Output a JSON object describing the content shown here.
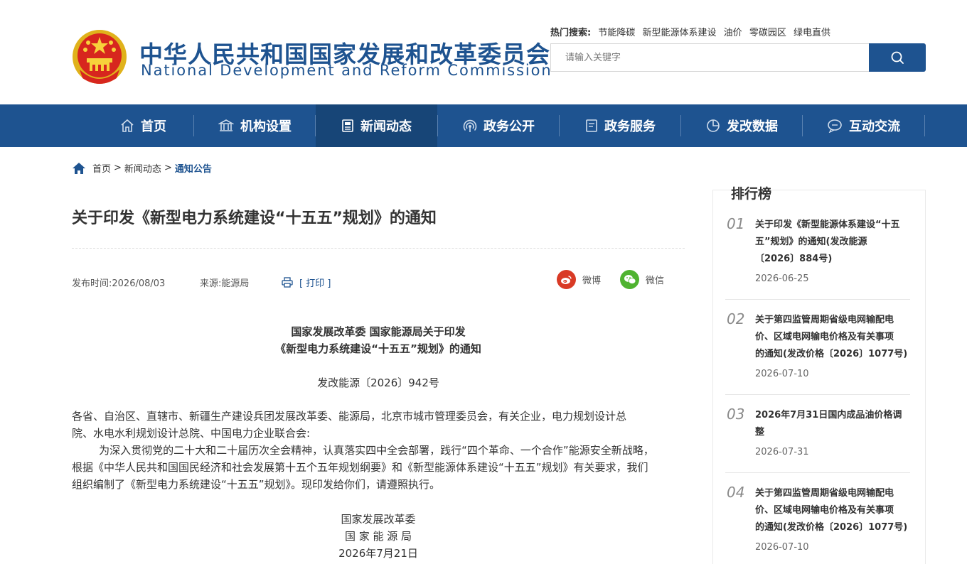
{
  "header": {
    "title_cn": "中华人民共和国国家发展和改革委员会",
    "title_en": "National Development and Reform Commission",
    "hot_label": "热门搜索:",
    "hot_items": [
      "节能降碳",
      "新型能源体系建设",
      "油价",
      "零碳园区",
      "绿电直供"
    ],
    "search_placeholder": "请输入关键字"
  },
  "nav": {
    "items": [
      {
        "label": "首页",
        "icon": "home-icon"
      },
      {
        "label": "机构设置",
        "icon": "building-icon"
      },
      {
        "label": "新闻动态",
        "icon": "news-icon"
      },
      {
        "label": "政务公开",
        "icon": "broadcast-icon"
      },
      {
        "label": "政务服务",
        "icon": "document-icon"
      },
      {
        "label": "发改数据",
        "icon": "pie-chart-icon"
      },
      {
        "label": "互动交流",
        "icon": "chat-icon"
      }
    ],
    "active_index": 2,
    "color": "#1e5390"
  },
  "breadcrumb": {
    "items": [
      "首页",
      "新闻动态"
    ],
    "current": "通知公告",
    "separator": ">"
  },
  "article": {
    "title": "关于印发《新型电力系统建设“十五五”规划》的通知",
    "publish_label": "发布时间:2026/08/03",
    "source_label": "来源:能源局",
    "print_label": "[ 打印 ]",
    "share_weibo": "微博",
    "share_wechat": "微信",
    "doc_head_line1": "国家发展改革委 国家能源局关于印发",
    "doc_head_line2": "《新型电力系统建设“十五五”规划》的通知",
    "doc_number": "发改能源〔2026〕942号",
    "paragraphs": [
      "各省、自治区、直辖市、新疆生产建设兵团发展改革委、能源局，北京市城市管理委员会，有关企业，电力规划设计总",
      "院、水电水利规划设计总院、中国电力企业联合会:",
      "        为深入贯彻党的二十大和二十届历次全会精神，认真落实四中全会部署，践行“四个革命、一个合作”能源安全新战略，",
      "根据《中华人民共和国国民经济和社会发展第十五个五年规划纲要》和《新型能源体系建设“十五五”规划》有关要求，我们",
      "组织编制了《新型电力系统建设“十五五”规划》。现印发给你们，请遵照执行。"
    ],
    "signature": [
      "国家发展改革委",
      "国 家 能 源 局",
      "2026年7月21日"
    ]
  },
  "ranking": {
    "title": "排行榜",
    "items": [
      {
        "num": "01",
        "lines": [
          "关于印发《新型能源体系建设“十五",
          "五”规划》的通知(发改能源",
          "〔2026〕884号)"
        ],
        "date": "2026-06-25"
      },
      {
        "num": "02",
        "lines": [
          "关于第四监管周期省级电网输配电",
          "价、区域电网输电价格及有关事项",
          "的通知(发改价格〔2026〕1077号)"
        ],
        "date": "2026-07-10"
      },
      {
        "num": "03",
        "lines": [
          "2026年7月31日国内成品油价格调",
          "整"
        ],
        "date": "2026-07-31"
      },
      {
        "num": "04",
        "lines": [
          "关于第四监管周期省级电网输配电",
          "价、区域电网输电价格及有关事项",
          "的通知(发改价格〔2026〕1077号)"
        ],
        "date": "2026-07-10"
      }
    ]
  }
}
